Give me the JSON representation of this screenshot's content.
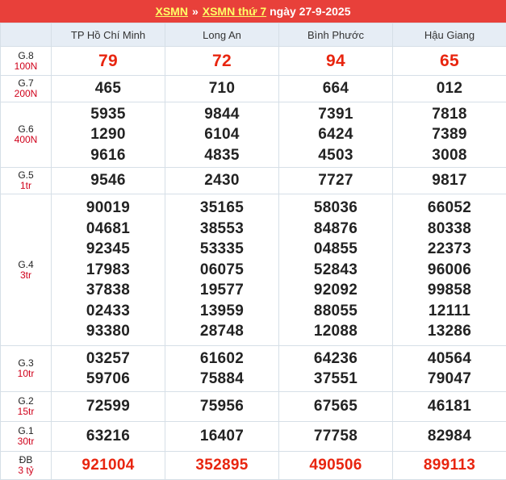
{
  "header": {
    "xsmn": "XSMN",
    "separator": "»",
    "title_link": "XSMN thứ 7",
    "date_text": "ngày 27-9-2025"
  },
  "provinces": [
    "TP Hồ Chí Minh",
    "Long An",
    "Bình Phước",
    "Hậu Giang"
  ],
  "prizes": [
    {
      "label": "G.8",
      "amount": "100N",
      "numbers": [
        [
          "79"
        ],
        [
          "72"
        ],
        [
          "94"
        ],
        [
          "65"
        ]
      ]
    },
    {
      "label": "G.7",
      "amount": "200N",
      "numbers": [
        [
          "465"
        ],
        [
          "710"
        ],
        [
          "664"
        ],
        [
          "012"
        ]
      ]
    },
    {
      "label": "G.6",
      "amount": "400N",
      "numbers": [
        [
          "5935",
          "1290",
          "9616"
        ],
        [
          "9844",
          "6104",
          "4835"
        ],
        [
          "7391",
          "6424",
          "4503"
        ],
        [
          "7818",
          "7389",
          "3008"
        ]
      ]
    },
    {
      "label": "G.5",
      "amount": "1tr",
      "numbers": [
        [
          "9546"
        ],
        [
          "2430"
        ],
        [
          "7727"
        ],
        [
          "9817"
        ]
      ]
    },
    {
      "label": "G.4",
      "amount": "3tr",
      "numbers": [
        [
          "90019",
          "04681",
          "92345",
          "17983",
          "37838",
          "02433",
          "93380"
        ],
        [
          "35165",
          "38553",
          "53335",
          "06075",
          "19577",
          "13959",
          "28748"
        ],
        [
          "58036",
          "84876",
          "04855",
          "52843",
          "92092",
          "88055",
          "12088"
        ],
        [
          "66052",
          "80338",
          "22373",
          "96006",
          "99858",
          "12111",
          "13286"
        ]
      ]
    },
    {
      "label": "G.3",
      "amount": "10tr",
      "numbers": [
        [
          "03257",
          "59706"
        ],
        [
          "61602",
          "75884"
        ],
        [
          "64236",
          "37551"
        ],
        [
          "40564",
          "79047"
        ]
      ]
    },
    {
      "label": "G.2",
      "amount": "15tr",
      "numbers": [
        [
          "72599"
        ],
        [
          "75956"
        ],
        [
          "67565"
        ],
        [
          "46181"
        ]
      ]
    },
    {
      "label": "G.1",
      "amount": "30tr",
      "numbers": [
        [
          "63216"
        ],
        [
          "16407"
        ],
        [
          "77758"
        ],
        [
          "82984"
        ]
      ]
    },
    {
      "label": "ĐB",
      "amount": "3 tỷ",
      "numbers": [
        [
          "921004"
        ],
        [
          "352895"
        ],
        [
          "490506"
        ],
        [
          "899113"
        ]
      ]
    }
  ],
  "colors": {
    "header_bg": "#e8403a",
    "header_link": "#ffff66",
    "prize_amount": "#d0021b",
    "highlight_number": "#e8250f",
    "column_header_bg": "#e6edf5",
    "border": "#d6dfe7"
  }
}
